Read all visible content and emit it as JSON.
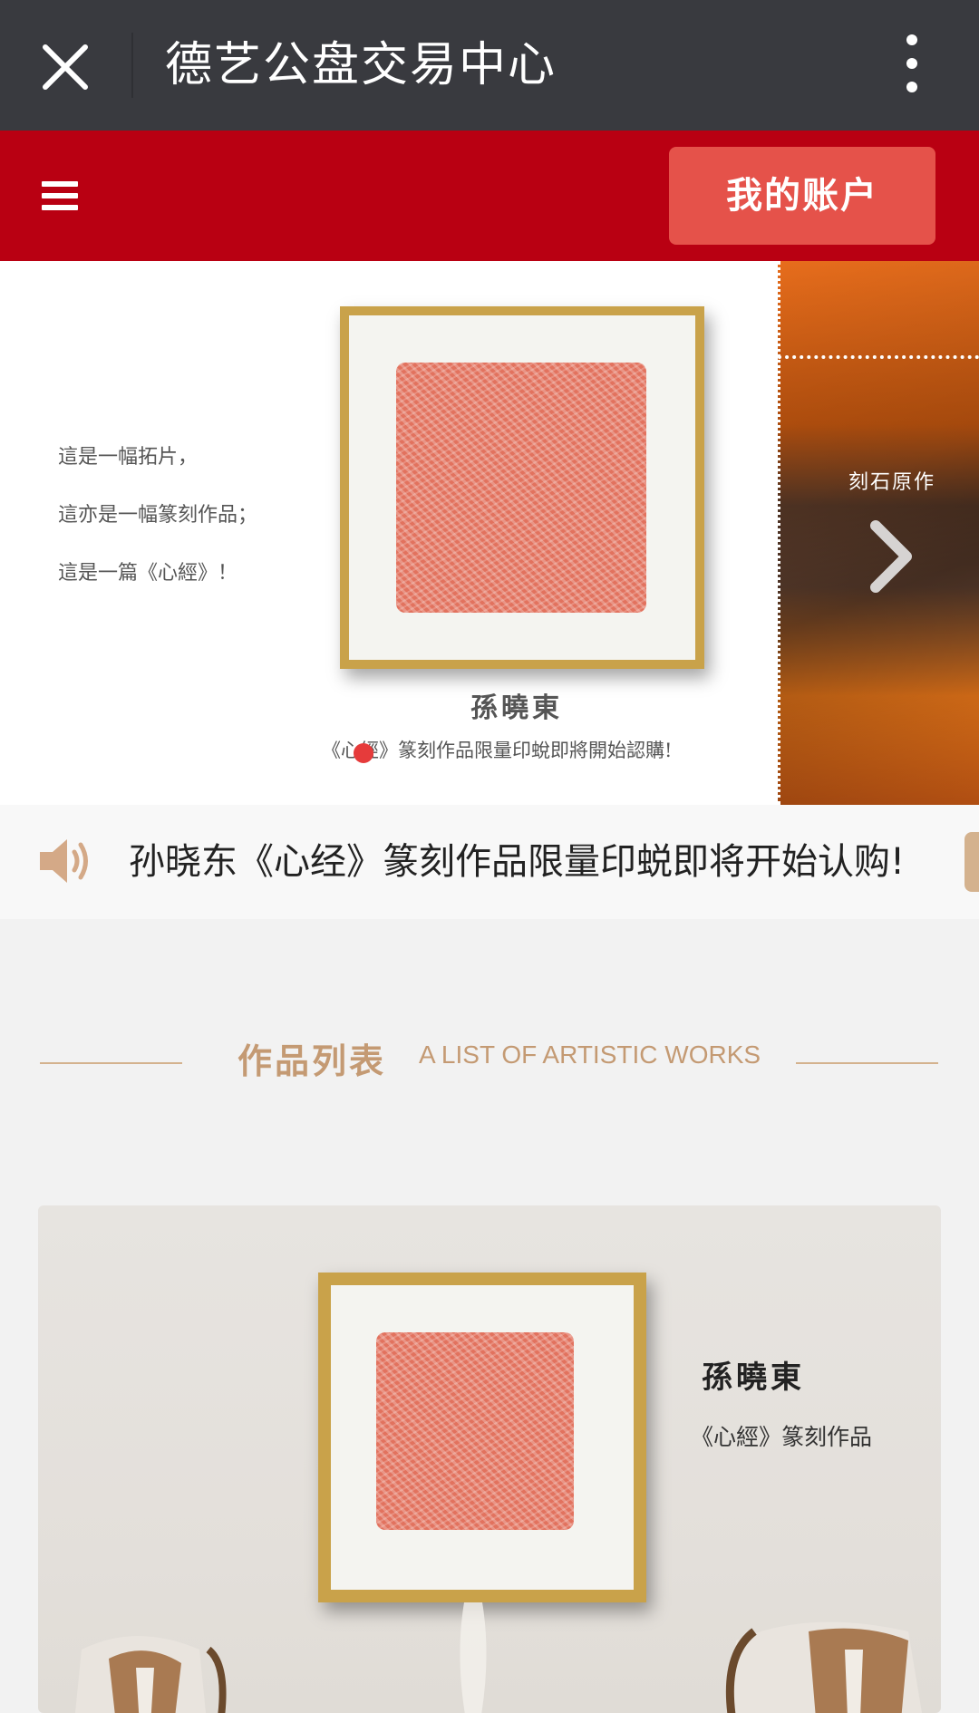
{
  "titlebar": {
    "title": "德艺公盘交易中心"
  },
  "navbar": {
    "account_button": "我的账户"
  },
  "banner": {
    "lines": [
      "這是一幅拓片，",
      "這亦是一幅篆刻作品；",
      "這是一篇《心經》！"
    ],
    "artist": "孫曉東",
    "caption": "《心經》篆刻作品限量印蛻即將開始認購!",
    "next_slide_label": "刻石原作"
  },
  "notice": {
    "text": "孙晓东《心经》篆刻作品限量印蜕即将开始认购!"
  },
  "section": {
    "title_cn": "作品列表",
    "title_en": "A LIST OF ARTISTIC WORKS"
  },
  "work_card": {
    "artist": "孫曉東",
    "caption": "《心經》篆刻作品"
  },
  "colors": {
    "titlebar_bg": "#393a3f",
    "navbar_red": "#b90012",
    "account_button": "#e5524a",
    "section_accent": "#c49a73"
  },
  "icons": [
    "close-icon",
    "more-vertical-icon",
    "menu-icon",
    "speaker-icon",
    "chevron-right-icon"
  ]
}
